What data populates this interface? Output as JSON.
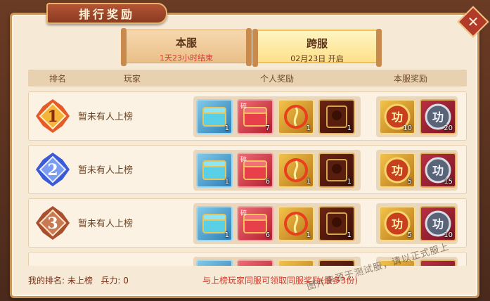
{
  "title": "排行奖励",
  "close_label": "✕",
  "tabs": [
    {
      "label": "本服",
      "sub": "1天23小时结束"
    },
    {
      "label": "跨服",
      "sub": "02月23日 开启"
    }
  ],
  "columns": {
    "rank": "排名",
    "player": "玩家",
    "personal": "个人奖励",
    "server": "本服奖励"
  },
  "rows": [
    {
      "rank": "1",
      "player": "暂未有人上榜",
      "personal_counts": [
        "1",
        "7",
        "1",
        "1"
      ],
      "server_counts": [
        "10",
        "20"
      ]
    },
    {
      "rank": "2",
      "player": "暂未有人上榜",
      "personal_counts": [
        "1",
        "6",
        "1",
        "1"
      ],
      "server_counts": [
        "5",
        "15"
      ]
    },
    {
      "rank": "3",
      "player": "暂未有人上榜",
      "personal_counts": [
        "1",
        "6",
        "1",
        "1"
      ],
      "server_counts": [
        "5",
        "10"
      ]
    }
  ],
  "item_glyph": "功",
  "badge_tags": [
    "碎",
    "碎"
  ],
  "footer": {
    "mine_label": "我的排名:",
    "mine_value": "未上榜",
    "power_label": "兵力:",
    "power_value": "0",
    "notice": "与上榜玩家同服可领取同服奖励(最多3份)"
  },
  "watermark": "图片来源于测试服，请以正式服上",
  "colors": {
    "accent_red": "#d23a2c",
    "panel": "#f6ead6",
    "banner": "#8c3a22"
  }
}
